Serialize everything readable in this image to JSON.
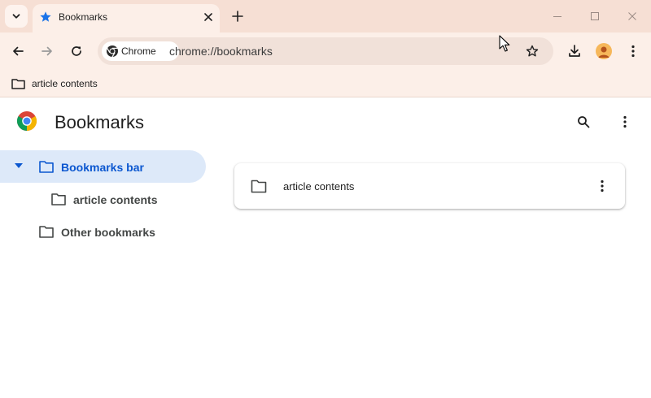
{
  "browser": {
    "tab": {
      "title": "Bookmarks",
      "favicon": "star-icon"
    },
    "toolbar": {
      "chip_label": "Chrome",
      "url": "chrome://bookmarks"
    },
    "bookmarks_bar": {
      "items": [
        {
          "label": "article contents",
          "icon": "folder-icon"
        }
      ]
    },
    "colors": {
      "tabstrip_bg": "#f6dfd4",
      "toolbar_bg": "#fcefe8",
      "accent": "#0b57d0",
      "selected_row_bg": "#dde9f9"
    }
  },
  "page": {
    "title": "Bookmarks",
    "sidebar": {
      "items": [
        {
          "label": "Bookmarks bar",
          "selected": true,
          "expanded": true
        },
        {
          "label": "article contents",
          "selected": false
        },
        {
          "label": "Other bookmarks",
          "selected": false
        }
      ]
    },
    "list": {
      "items": [
        {
          "label": "article contents",
          "icon": "folder-icon"
        }
      ]
    }
  }
}
